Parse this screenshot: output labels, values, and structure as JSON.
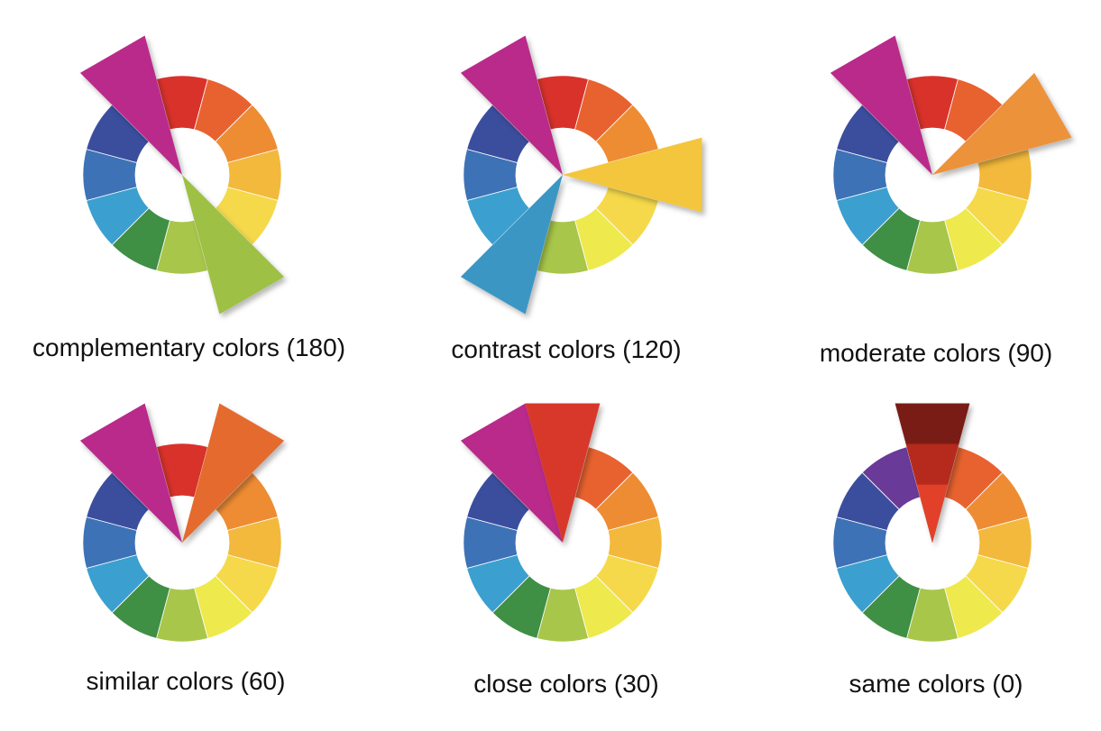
{
  "wheel_colors": [
    "#d9322b",
    "#e8622f",
    "#ee8c34",
    "#f3b93c",
    "#f5d94a",
    "#eee94d",
    "#a8c64a",
    "#3f8f45",
    "#3ba0cf",
    "#3e72b6",
    "#3b4e9e",
    "#6a3a99"
  ],
  "panels": [
    {
      "caption": "complementary colors (180)",
      "highlights": [
        {
          "slot": 11,
          "color": "#b92a8a"
        },
        {
          "slot": 5,
          "color": "#9dc044"
        }
      ]
    },
    {
      "caption": "contrast colors (120)",
      "highlights": [
        {
          "slot": 11,
          "color": "#b92a8a"
        },
        {
          "slot": 3,
          "color": "#f3c63e"
        },
        {
          "slot": 7,
          "color": "#3b96c4"
        }
      ]
    },
    {
      "caption": "moderate colors (90)",
      "highlights": [
        {
          "slot": 11,
          "color": "#b92a8a"
        },
        {
          "slot": 2,
          "color": "#ec923a"
        }
      ]
    },
    {
      "caption": "similar colors (60)",
      "highlights": [
        {
          "slot": 11,
          "color": "#b92a8a"
        },
        {
          "slot": 1,
          "color": "#e46a2e"
        }
      ]
    },
    {
      "caption": "close colors (30)",
      "highlights": [
        {
          "slot": 11,
          "color": "#b92a8a"
        },
        {
          "slot": 0,
          "color": "#d8392b"
        }
      ]
    },
    {
      "caption": "same colors (0)",
      "highlights": [
        {
          "slot": 0,
          "color": "#c33125",
          "bands": [
            "#7a1a12",
            "#b52a1f",
            "#e3402b"
          ]
        }
      ]
    }
  ]
}
